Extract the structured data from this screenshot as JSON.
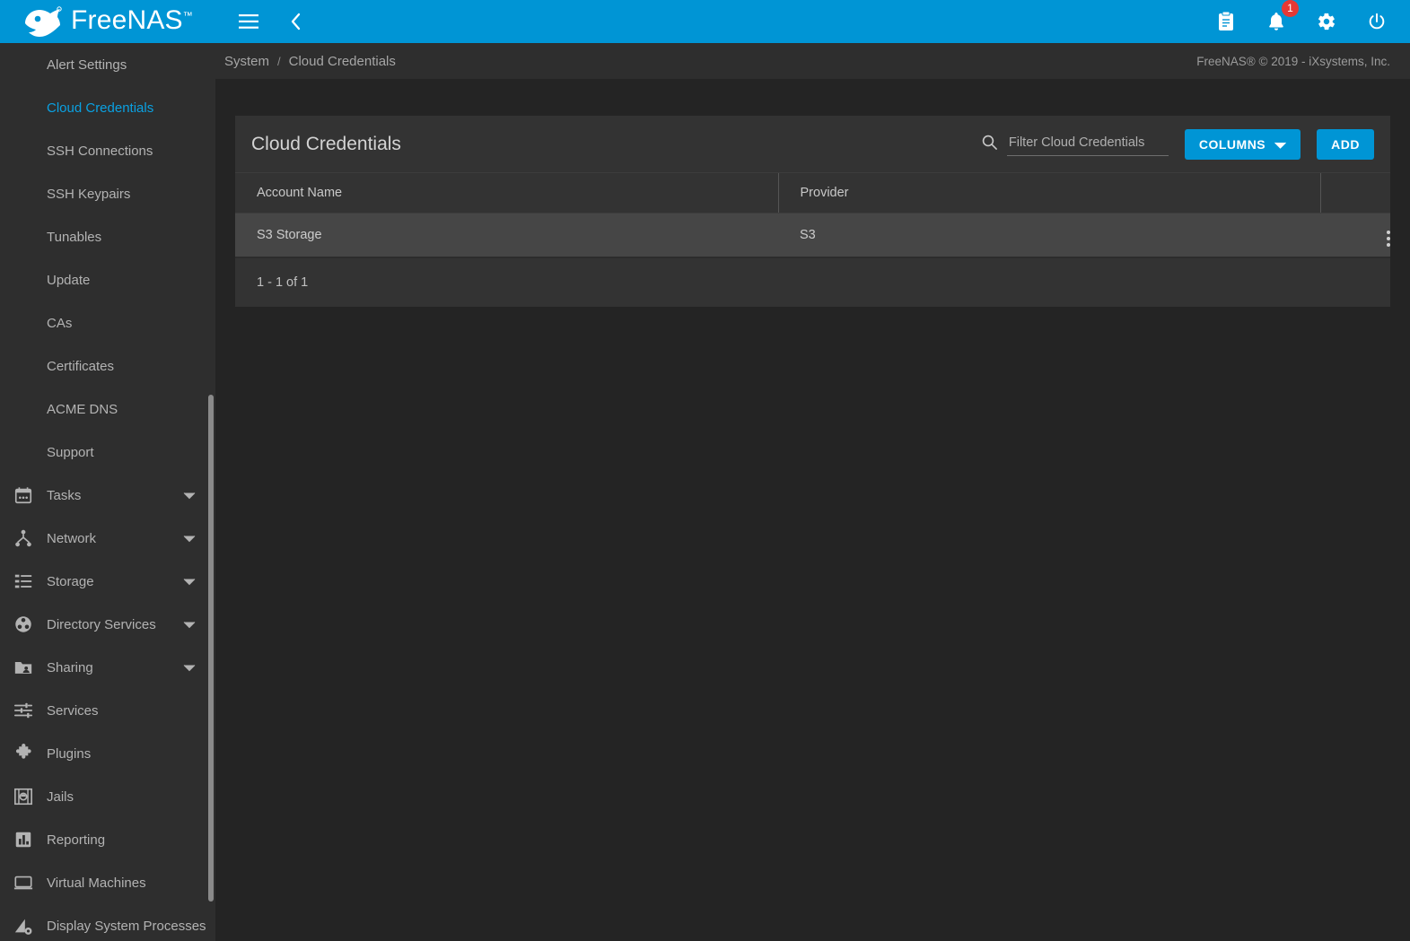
{
  "brand": {
    "name": "FreeNAS",
    "trademark": "™",
    "logo_icon": "freenas-fish-logo"
  },
  "topbar": {
    "menu_icon": "hamburger-menu-icon",
    "back_icon": "chevron-left-icon",
    "clipboard_icon": "clipboard-icon",
    "bell_icon": "bell-icon",
    "notification_count": "1",
    "settings_icon": "gear-icon",
    "power_icon": "power-icon",
    "accent_color": "#0095d5"
  },
  "sidebar": {
    "items": [
      {
        "label": "Alert Settings",
        "icon": "",
        "sub": true,
        "active": false,
        "caret": false
      },
      {
        "label": "Cloud Credentials",
        "icon": "",
        "sub": true,
        "active": true,
        "caret": false
      },
      {
        "label": "SSH Connections",
        "icon": "",
        "sub": true,
        "active": false,
        "caret": false
      },
      {
        "label": "SSH Keypairs",
        "icon": "",
        "sub": true,
        "active": false,
        "caret": false
      },
      {
        "label": "Tunables",
        "icon": "",
        "sub": true,
        "active": false,
        "caret": false
      },
      {
        "label": "Update",
        "icon": "",
        "sub": true,
        "active": false,
        "caret": false
      },
      {
        "label": "CAs",
        "icon": "",
        "sub": true,
        "active": false,
        "caret": false
      },
      {
        "label": "Certificates",
        "icon": "",
        "sub": true,
        "active": false,
        "caret": false
      },
      {
        "label": "ACME DNS",
        "icon": "",
        "sub": true,
        "active": false,
        "caret": false
      },
      {
        "label": "Support",
        "icon": "",
        "sub": true,
        "active": false,
        "caret": false
      },
      {
        "label": "Tasks",
        "icon": "calendar-icon",
        "sub": false,
        "active": false,
        "caret": true
      },
      {
        "label": "Network",
        "icon": "network-icon",
        "sub": false,
        "active": false,
        "caret": true
      },
      {
        "label": "Storage",
        "icon": "storage-list-icon",
        "sub": false,
        "active": false,
        "caret": true
      },
      {
        "label": "Directory Services",
        "icon": "directory-services-icon",
        "sub": false,
        "active": false,
        "caret": true
      },
      {
        "label": "Sharing",
        "icon": "sharing-folder-icon",
        "sub": false,
        "active": false,
        "caret": true
      },
      {
        "label": "Services",
        "icon": "sliders-icon",
        "sub": false,
        "active": false,
        "caret": false
      },
      {
        "label": "Plugins",
        "icon": "puzzle-piece-icon",
        "sub": false,
        "active": false,
        "caret": false
      },
      {
        "label": "Jails",
        "icon": "jail-icon",
        "sub": false,
        "active": false,
        "caret": false
      },
      {
        "label": "Reporting",
        "icon": "bar-chart-icon",
        "sub": false,
        "active": false,
        "caret": false
      },
      {
        "label": "Virtual Machines",
        "icon": "monitor-icon",
        "sub": false,
        "active": false,
        "caret": false
      },
      {
        "label": "Display System Processes",
        "icon": "processes-gear-icon",
        "sub": false,
        "active": false,
        "caret": false
      }
    ]
  },
  "breadcrumb": {
    "parent": "System",
    "separator": "/",
    "current": "Cloud Credentials"
  },
  "footer": {
    "copyright": "FreeNAS® © 2019 - iXsystems, Inc."
  },
  "card": {
    "title": "Cloud Credentials",
    "search": {
      "placeholder": "Filter Cloud Credentials",
      "value": "",
      "icon": "search-icon"
    },
    "columns_button": {
      "label": "COLUMNS",
      "caret_icon": "chevron-down-icon"
    },
    "add_button": {
      "label": "ADD"
    },
    "table": {
      "headers": [
        "Account Name",
        "Provider",
        ""
      ],
      "rows": [
        {
          "account_name": "S3 Storage",
          "provider": "S3",
          "menu_icon": "kebab-menu-icon"
        }
      ]
    },
    "pagination": "1 - 1 of 1"
  }
}
